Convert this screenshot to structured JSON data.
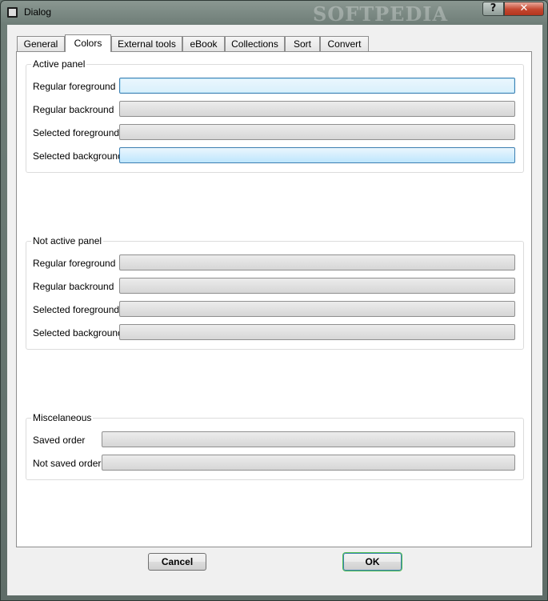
{
  "window": {
    "title": "Dialog",
    "watermark": "SOFTPEDIA"
  },
  "titlebar_buttons": {
    "help": "?",
    "close": "✕"
  },
  "tabs": [
    {
      "label": "General"
    },
    {
      "label": "Colors",
      "active": true
    },
    {
      "label": "External tools"
    },
    {
      "label": "eBook"
    },
    {
      "label": "Collections"
    },
    {
      "label": "Sort"
    },
    {
      "label": "Convert"
    }
  ],
  "groups": {
    "active_panel": {
      "title": "Active panel",
      "rows": [
        {
          "label": "Regular foreground"
        },
        {
          "label": "Regular backround"
        },
        {
          "label": "Selected foreground"
        },
        {
          "label": "Selected background"
        }
      ]
    },
    "not_active_panel": {
      "title": "Not active panel",
      "rows": [
        {
          "label": "Regular foreground"
        },
        {
          "label": "Regular backround"
        },
        {
          "label": "Selected foreground"
        },
        {
          "label": "Selected background"
        }
      ]
    },
    "miscelaneous": {
      "title": "Miscelaneous",
      "rows": [
        {
          "label": "Saved order"
        },
        {
          "label": "Not saved order"
        }
      ]
    }
  },
  "buttons": {
    "cancel": "Cancel",
    "ok": "OK"
  }
}
